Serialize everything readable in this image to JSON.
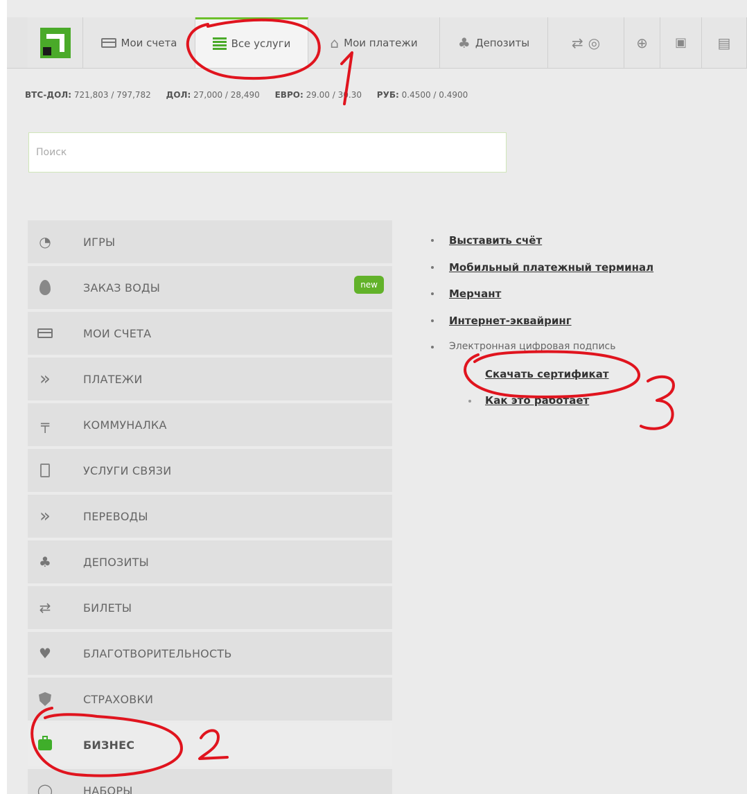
{
  "nav": {
    "tabs": [
      {
        "label": "Мои счета",
        "icon": "card-icon"
      },
      {
        "label": "Все услуги",
        "icon": "list-icon",
        "active": true
      },
      {
        "label": "Мои платежи",
        "icon": "home-icon"
      },
      {
        "label": "Депозиты",
        "icon": "piggy-icon"
      }
    ],
    "icon_tabs": [
      "tickets-icon",
      "plus-circle-icon",
      "help-icon",
      "cart-icon"
    ]
  },
  "rates": [
    {
      "label": "BTC-ДОЛ:",
      "value": "721,803 / 797,782"
    },
    {
      "label": "ДОЛ:",
      "value": "27,000 / 28,490"
    },
    {
      "label": "ЕВРО:",
      "value": "29.00 / 30.30"
    },
    {
      "label": "РУБ:",
      "value": "0.4500 / 0.4900"
    }
  ],
  "search": {
    "placeholder": "Поиск"
  },
  "menu": [
    {
      "label": "ИГРЫ",
      "icon": "gamepad-icon"
    },
    {
      "label": "ЗАКАЗ ВОДЫ",
      "icon": "water-drop-icon",
      "badge": "new"
    },
    {
      "label": "МОИ СЧЕТА",
      "icon": "card-icon"
    },
    {
      "label": "ПЛАТЕЖИ",
      "icon": "double-chevron-icon"
    },
    {
      "label": "КОММУНАЛКА",
      "icon": "faucet-icon"
    },
    {
      "label": "УСЛУГИ СВЯЗИ",
      "icon": "phone-icon"
    },
    {
      "label": "ПЕРЕВОДЫ",
      "icon": "double-chevron-icon"
    },
    {
      "label": "ДЕПОЗИТЫ",
      "icon": "piggy-icon"
    },
    {
      "label": "БИЛЕТЫ",
      "icon": "tickets-icon"
    },
    {
      "label": "БЛАГОТВОРИТЕЛЬНОСТЬ",
      "icon": "heart-hand-icon"
    },
    {
      "label": "СТРАХОВКИ",
      "icon": "shield-icon"
    },
    {
      "label": "БИЗНЕС",
      "icon": "briefcase-icon",
      "active": true
    },
    {
      "label": "НАБОРЫ",
      "icon": "circle-icon"
    }
  ],
  "links": {
    "items": [
      "Выставить счёт",
      "Мобильный платежный терминал",
      "Мерчант",
      "Интернет-эквайринг"
    ],
    "group_label": "Электронная цифровая подпись",
    "sub_items": [
      "Скачать сертификат",
      "Как это работает"
    ]
  },
  "annotations": {
    "marks": [
      "1",
      "2",
      "3"
    ],
    "color": "#e0141e"
  }
}
